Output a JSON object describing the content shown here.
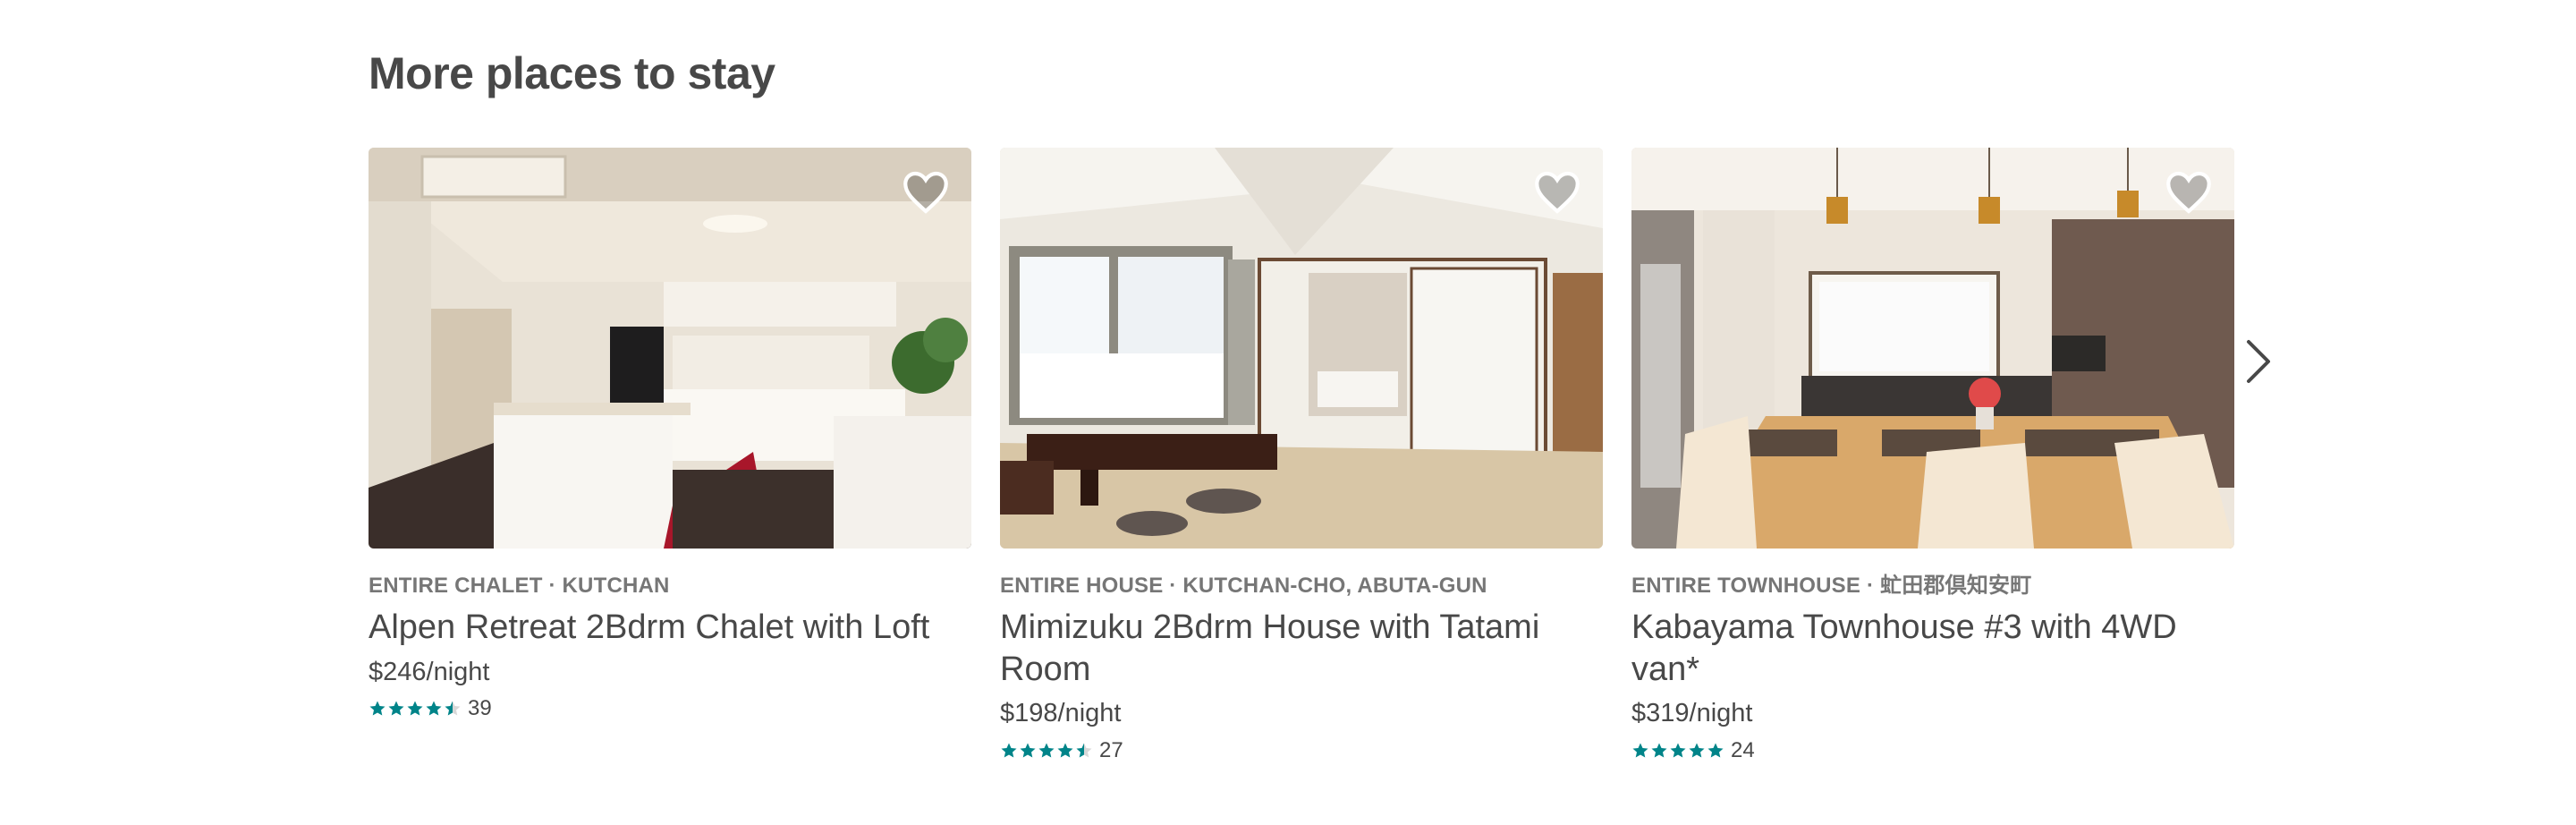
{
  "section": {
    "title": "More places to stay"
  },
  "listings": [
    {
      "kicker": "ENTIRE CHALET · KUTCHAN",
      "title": "Alpen Retreat 2Bdrm Chalet with Loft",
      "price": "$246/night",
      "rating": 4.5,
      "review_count": "39",
      "photo": "kitchen-interior"
    },
    {
      "kicker": "ENTIRE HOUSE · KUTCHAN-CHO, ABUTA-GUN",
      "title": "Mimizuku 2Bdrm House with Tatami Room",
      "price": "$198/night",
      "rating": 4.5,
      "review_count": "27",
      "photo": "tatami-living-room"
    },
    {
      "kicker": "ENTIRE TOWNHOUSE · 虻田郡倶知安町",
      "title": "Kabayama Townhouse #3 with 4WD van*",
      "price": "$319/night",
      "rating": 5,
      "review_count": "24",
      "photo": "dining-room"
    }
  ],
  "icons": {
    "save": "heart-icon",
    "next": "chevron-right-icon",
    "star": "star-icon"
  },
  "colors": {
    "star": "#008489",
    "text": "#484848",
    "muted": "#767676"
  }
}
